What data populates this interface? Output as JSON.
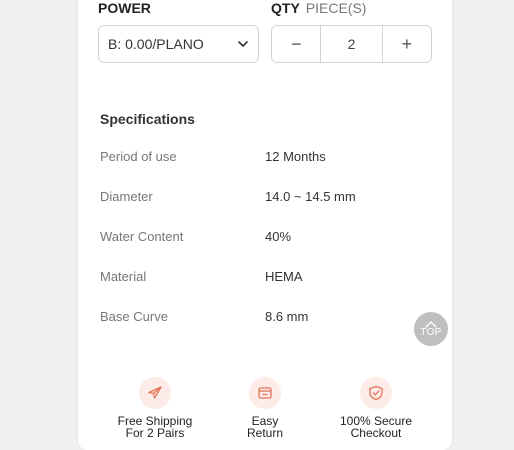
{
  "power": {
    "label": "POWER",
    "selected": "B: 0.00/PLANO"
  },
  "qty": {
    "label": "QTY",
    "unit": "PIECE(S)",
    "minus": "−",
    "value": "2",
    "plus": "+"
  },
  "specs": {
    "title": "Specifications",
    "rows": [
      {
        "key": "Period of use",
        "value": "12 Months"
      },
      {
        "key": "Diameter",
        "value": "14.0 ~ 14.5 mm"
      },
      {
        "key": "Water Content",
        "value": "40%"
      },
      {
        "key": "Material",
        "value": "HEMA"
      },
      {
        "key": "Base Curve",
        "value": "8.6 mm"
      }
    ]
  },
  "top_button": {
    "label": "TOP"
  },
  "features": [
    {
      "icon": "plane-icon",
      "line1": "Free Shipping",
      "line2": "For 2 Pairs"
    },
    {
      "icon": "return-box-icon",
      "line1": "Easy",
      "line2": "Return"
    },
    {
      "icon": "shield-check-icon",
      "line1": "100% Secure",
      "line2": "Checkout"
    }
  ],
  "colors": {
    "accent": "#e8735a",
    "accent_bg": "#fcebe6",
    "top_button_bg": "#bfbfbf"
  }
}
